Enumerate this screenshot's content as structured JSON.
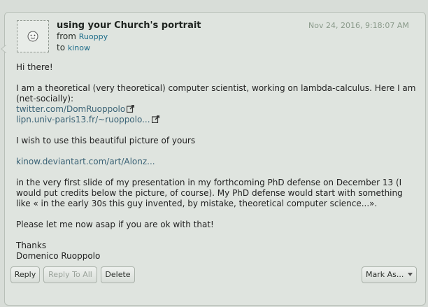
{
  "message": {
    "subject": "using your Church's portrait",
    "from_label": "from",
    "from_user": "Ruoppy",
    "to_label": "to",
    "to_user": "kinow",
    "date": "Nov 24, 2016, 9:18:07 AM"
  },
  "body": {
    "greeting": "Hi there!",
    "intro": "I am a theoretical (very theoretical) computer scientist, working on lambda-calculus. Here I am (net-socially):",
    "link1": "twitter.com/DomRuoppolo",
    "link2": "lipn.univ-paris13.fr/~ruoppolo...",
    "request": "I wish to use this beautiful picture of yours",
    "link3": "kinow.deviantart.com/art/Alonz...",
    "para": "in the very first slide of my presentation in my forthcoming PhD defense on December 13 (I would put credits below the picture, of course). My PhD defense would start with something like « in the early 30s this guy invented, by mistake, theoretical computer science...».",
    "ask": "Please let me now asap if you are ok with that!",
    "thanks": "Thanks",
    "signature": "Domenico Ruoppolo"
  },
  "actions": {
    "reply": "Reply",
    "reply_all": "Reply To All",
    "delete": "Delete",
    "mark_as": "Mark As..."
  },
  "icons": {
    "avatar": "smiley-avatar-icon",
    "external_link": "external-link-icon",
    "dropdown": "chevron-down-icon"
  }
}
